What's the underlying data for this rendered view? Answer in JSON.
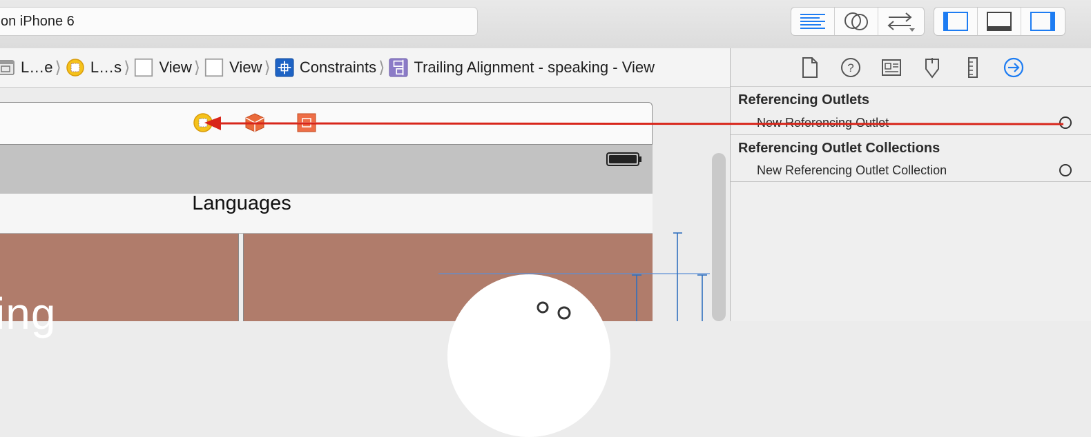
{
  "toolbar": {
    "activity_text": "on iPhone 6",
    "editor_buttons": [
      "standard-editor",
      "assistant-editor",
      "version-editor"
    ],
    "panel_buttons": [
      "navigator-panel",
      "debug-panel",
      "utilities-panel"
    ]
  },
  "jumpbar": {
    "crumbs": [
      {
        "label": "L…e",
        "icon": "scene-icon"
      },
      {
        "label": "L…s",
        "icon": "view-controller-icon"
      },
      {
        "label": "View",
        "icon": "view-icon"
      },
      {
        "label": "View",
        "icon": "view-icon"
      },
      {
        "label": "Constraints",
        "icon": "constraints-icon"
      },
      {
        "label": "Trailing Alignment - speaking - View",
        "icon": "trailing-alignment-icon"
      }
    ]
  },
  "canvas": {
    "nav_title": "Languages",
    "speaking_text": "king",
    "dock_icons": [
      "view-controller-icon",
      "first-responder-icon",
      "exit-icon"
    ]
  },
  "inspector": {
    "tabs": [
      "file-inspector",
      "quick-help-inspector",
      "identity-inspector",
      "attributes-inspector",
      "size-inspector",
      "connections-inspector"
    ],
    "active_tab": "connections-inspector",
    "referencing_outlets": {
      "title": "Referencing Outlets",
      "item": "New Referencing Outlet"
    },
    "referencing_outlet_collections": {
      "title": "Referencing Outlet Collections",
      "item": "New Referencing Outlet Collection"
    }
  },
  "colors": {
    "accent": "#1d7cf2",
    "drag_line": "#d8261b",
    "view_background": "#b07c6b"
  }
}
